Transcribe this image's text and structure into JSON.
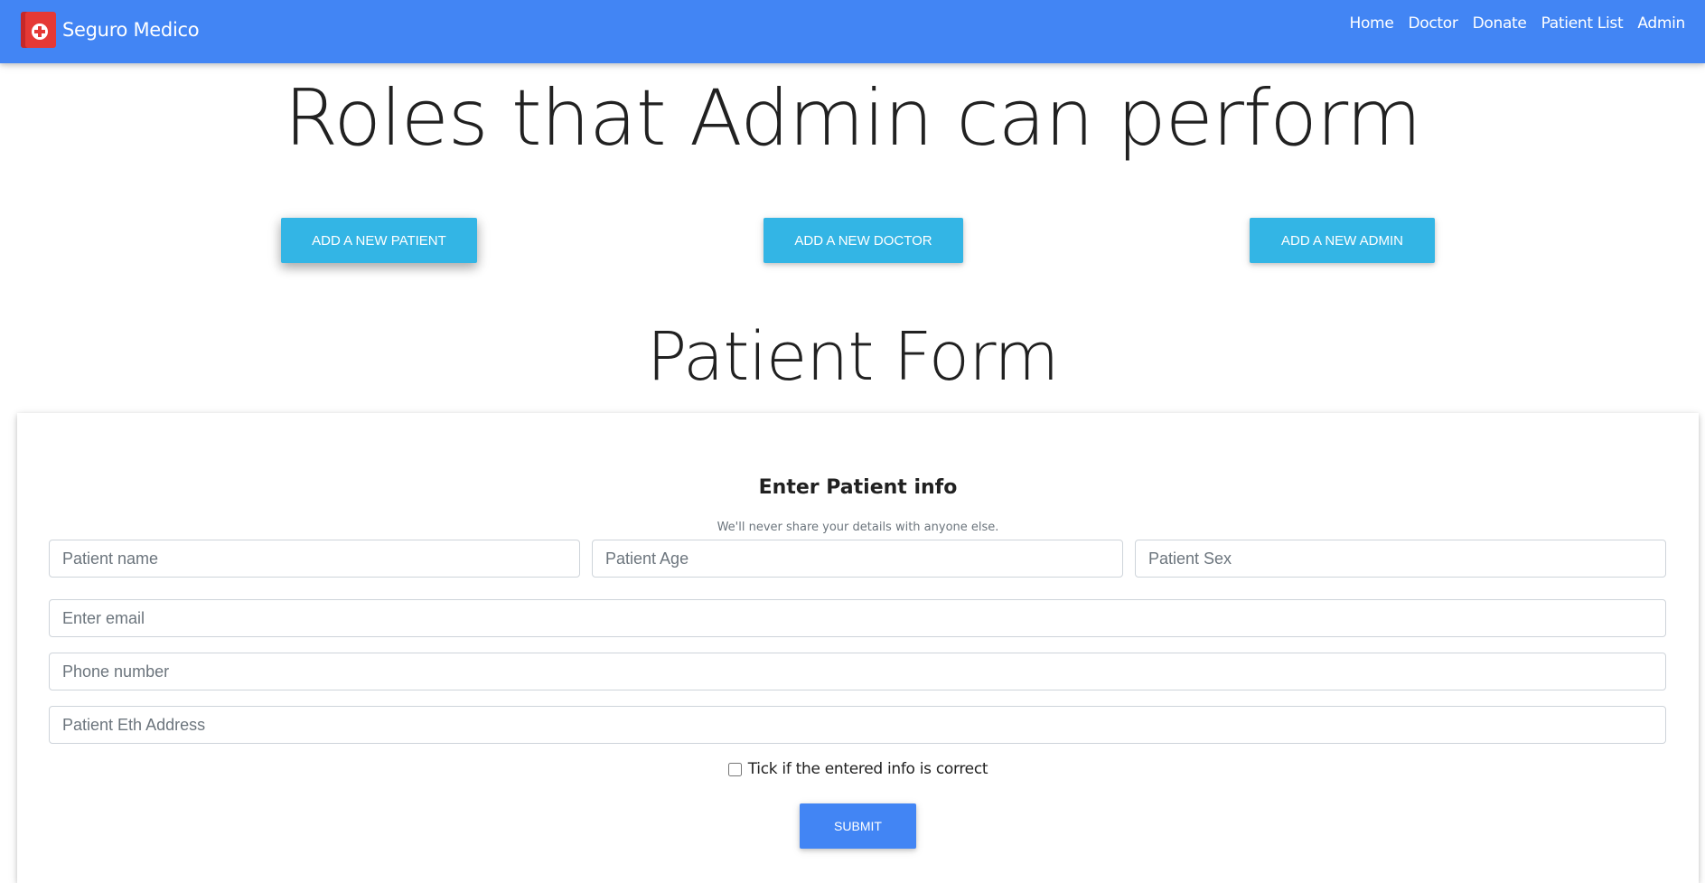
{
  "navbar": {
    "brand": "Seguro Medico",
    "brand_icon": "medical-cross-icon",
    "links": [
      "Home",
      "Doctor",
      "Donate",
      "Patient List",
      "Admin"
    ]
  },
  "hero": {
    "title": "Roles that Admin can perform"
  },
  "roles": {
    "add_patient": "ADD A NEW PATIENT",
    "add_doctor": "ADD A NEW DOCTOR",
    "add_admin": "ADD A NEW ADMIN"
  },
  "form": {
    "title": "Patient Form",
    "heading": "Enter Patient info",
    "privacy_note": "We'll never share your details with anyone else.",
    "fields": {
      "name_placeholder": "Patient name",
      "age_placeholder": "Patient Age",
      "sex_placeholder": "Patient Sex",
      "email_placeholder": "Enter email",
      "phone_placeholder": "Phone number",
      "eth_placeholder": "Patient Eth Address"
    },
    "checkbox_label": "Tick if the entered info is correct",
    "submit_label": "SUBMIT"
  },
  "colors": {
    "navbar": "#4285f4",
    "role_button": "#33b5e5",
    "submit_button": "#4285f4",
    "logo": "#e53935"
  }
}
